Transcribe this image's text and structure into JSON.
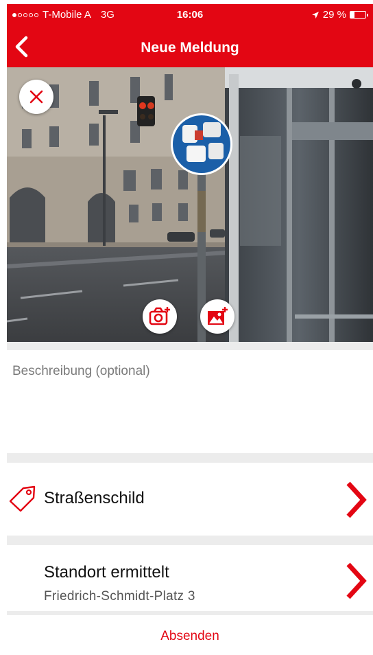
{
  "status_bar": {
    "carrier": "T-Mobile A",
    "network": "3G",
    "time": "16:06",
    "battery": "29 %",
    "battery_level": 0.29,
    "signal_bars_filled": 1,
    "signal_bars_total": 5
  },
  "nav": {
    "title": "Neue Meldung",
    "back_icon": "chevron-left-icon"
  },
  "photo": {
    "remove_icon": "close-icon",
    "camera_icon": "camera-add-icon",
    "gallery_icon": "gallery-add-icon"
  },
  "description": {
    "placeholder": "Beschreibung (optional)",
    "value": ""
  },
  "category": {
    "label": "Straßenschild",
    "icon": "tag-icon"
  },
  "location": {
    "label": "Standort ermittelt",
    "address": "Friedrich-Schmidt-Platz 3"
  },
  "submit": {
    "label": "Absenden"
  },
  "colors": {
    "accent": "#e30613",
    "separator": "#ececec"
  }
}
